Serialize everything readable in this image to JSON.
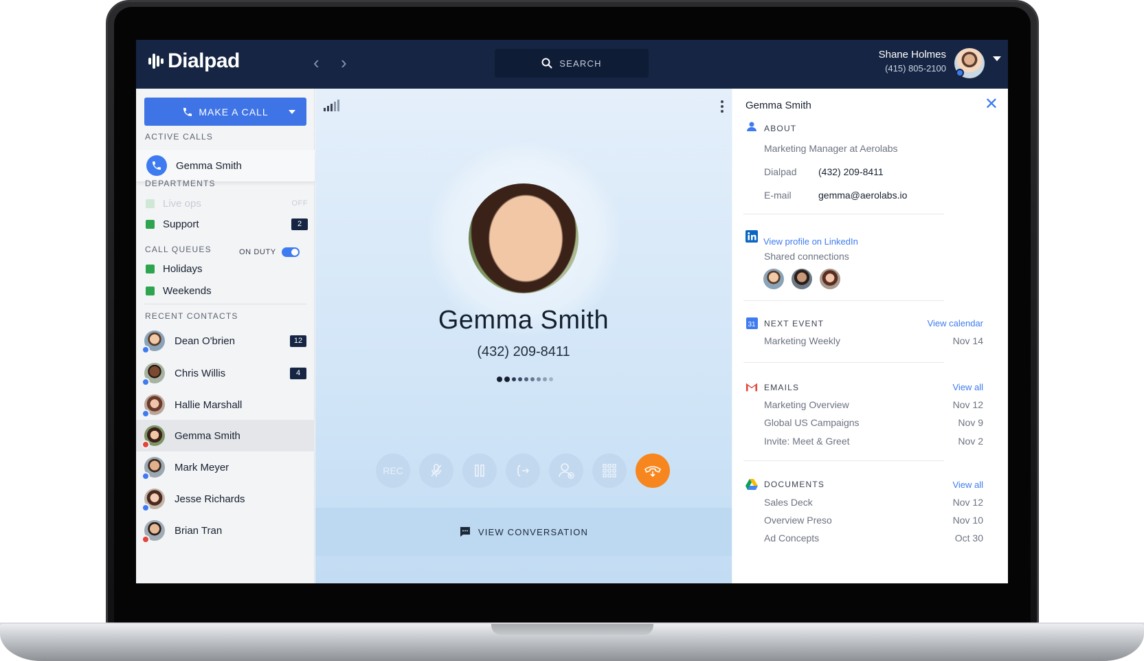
{
  "app": {
    "logo_text": "Dialpad",
    "search_label": "SEARCH",
    "user_name": "Shane Holmes",
    "user_phone": "(415) 805-2100"
  },
  "sidebar": {
    "make_call_label": "MAKE A CALL",
    "active_calls_title": "ACTIVE CALLS",
    "active_call_name": "Gemma Smith",
    "departments_title": "DEPARTMENTS",
    "departments": [
      {
        "name": "Live ops",
        "status": "OFF",
        "active": false
      },
      {
        "name": "Support",
        "count": "2",
        "active": true
      }
    ],
    "call_queues_title": "CALL QUEUES",
    "on_duty_label": "ON DUTY",
    "queues": [
      {
        "name": "Holidays"
      },
      {
        "name": "Weekends"
      }
    ],
    "recent_contacts_title": "RECENT CONTACTS",
    "contacts": [
      {
        "name": "Dean O'brien",
        "count": "12",
        "status": "blue"
      },
      {
        "name": "Chris Willis",
        "count": "4",
        "status": "blue"
      },
      {
        "name": "Hallie Marshall",
        "status": "blue"
      },
      {
        "name": "Gemma Smith",
        "status": "red",
        "selected": true
      },
      {
        "name": "Mark Meyer",
        "status": "blue"
      },
      {
        "name": "Jesse Richards",
        "status": "blue"
      },
      {
        "name": "Brian Tran",
        "status": "red"
      }
    ]
  },
  "call": {
    "name": "Gemma Smith",
    "phone": "(432) 209-8411",
    "rec_label": "REC",
    "view_conversation_label": "VIEW CONVERSATION"
  },
  "panel": {
    "name": "Gemma Smith",
    "about_title": "ABOUT",
    "title_line": "Marketing Manager at Aerolabs",
    "dialpad_label": "Dialpad",
    "dialpad_value": "(432) 209-8411",
    "email_label": "E-mail",
    "email_value": "gemma@aerolabs.io",
    "linkedin_link": "View profile on LinkedIn",
    "shared_connections": "Shared connections",
    "next_event_title": "NEXT EVENT",
    "view_calendar": "View calendar",
    "calendar_icon_text": "31",
    "event_name": "Marketing Weekly",
    "event_date": "Nov 14",
    "emails_title": "EMAILS",
    "emails_view_all": "View all",
    "emails": [
      {
        "subject": "Marketing Overview",
        "date": "Nov 12"
      },
      {
        "subject": "Global US Campaigns",
        "date": "Nov 9"
      },
      {
        "subject": "Invite: Meet & Greet",
        "date": "Nov 2"
      }
    ],
    "documents_title": "DOCUMENTS",
    "documents_view_all": "View all",
    "documents": [
      {
        "name": "Sales Deck",
        "date": "Nov 12"
      },
      {
        "name": "Overview Preso",
        "date": "Nov 10"
      },
      {
        "name": "Ad Concepts",
        "date": "Oct 30"
      }
    ]
  },
  "colors": {
    "topbar": "#152543",
    "accent_blue": "#3e7bf0",
    "end_call_orange": "#f7861e",
    "department_green": "#2ea44f"
  },
  "icons": [
    "back-arrow-icon",
    "forward-arrow-icon",
    "search-icon",
    "phone-icon",
    "signal-icon",
    "more-vertical-icon",
    "mute-icon",
    "pause-icon",
    "transfer-icon",
    "add-person-icon",
    "keypad-icon",
    "end-call-icon",
    "chat-icon",
    "close-icon",
    "person-icon",
    "linkedin-icon",
    "calendar-icon",
    "gmail-icon",
    "google-drive-icon"
  ]
}
